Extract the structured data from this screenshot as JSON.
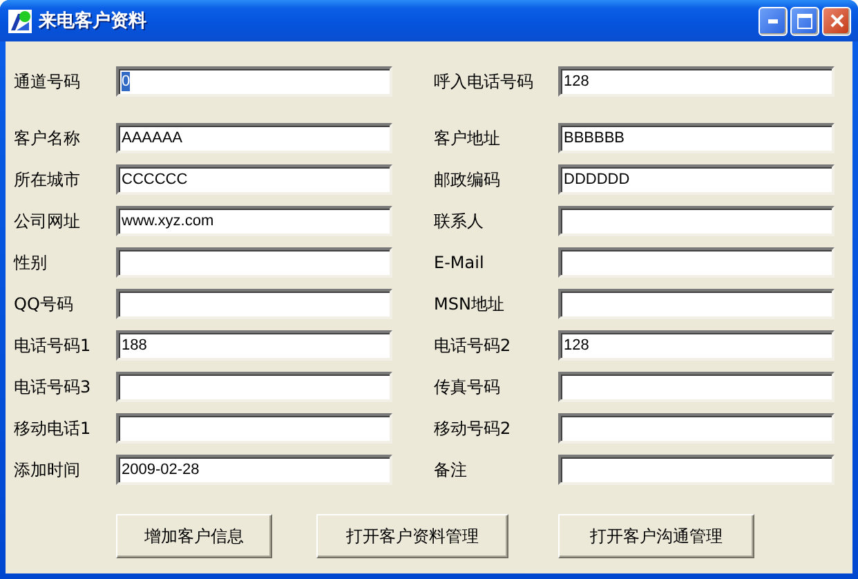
{
  "window": {
    "title": "来电客户资料",
    "controls": [
      {
        "kind": "minimize"
      },
      {
        "kind": "maximize"
      },
      {
        "kind": "close"
      }
    ]
  },
  "top_row": [
    {
      "label": "通道号码",
      "value": "0",
      "focused": true
    },
    {
      "label": "呼入电话号码",
      "value": "128",
      "focused": false
    }
  ],
  "rows": [
    [
      {
        "label": "客户名称",
        "value": "AAAAAA",
        "focused": false
      },
      {
        "label": "客户地址",
        "value": "BBBBBB",
        "focused": false
      }
    ],
    [
      {
        "label": "所在城市",
        "value": "CCCCCC",
        "focused": false
      },
      {
        "label": "邮政编码",
        "value": "DDDDDD",
        "focused": false
      }
    ],
    [
      {
        "label": "公司网址",
        "value": "www.xyz.com",
        "focused": false
      },
      {
        "label": "联系人",
        "focused": false
      }
    ],
    [
      {
        "label": "性别",
        "focused": false
      },
      {
        "label": "E-Mail",
        "focused": false
      }
    ],
    [
      {
        "label": "QQ号码",
        "focused": false
      },
      {
        "label": "MSN地址",
        "focused": false
      }
    ],
    [
      {
        "label": "电话号码1",
        "value": "188",
        "focused": false
      },
      {
        "label": "电话号码2",
        "value": "128",
        "focused": false
      }
    ],
    [
      {
        "label": "电话号码3",
        "focused": false
      },
      {
        "label": "传真号码",
        "focused": false
      }
    ],
    [
      {
        "label": "移动电话1",
        "focused": false
      },
      {
        "label": "移动号码2",
        "focused": false
      }
    ],
    [
      {
        "label": "添加时间",
        "value": "2009-02-28",
        "focused": false
      },
      {
        "label": "备注",
        "focused": false
      }
    ]
  ],
  "buttons": [
    "增加客户信息",
    "打开客户资料管理",
    "打开客户沟通管理"
  ]
}
